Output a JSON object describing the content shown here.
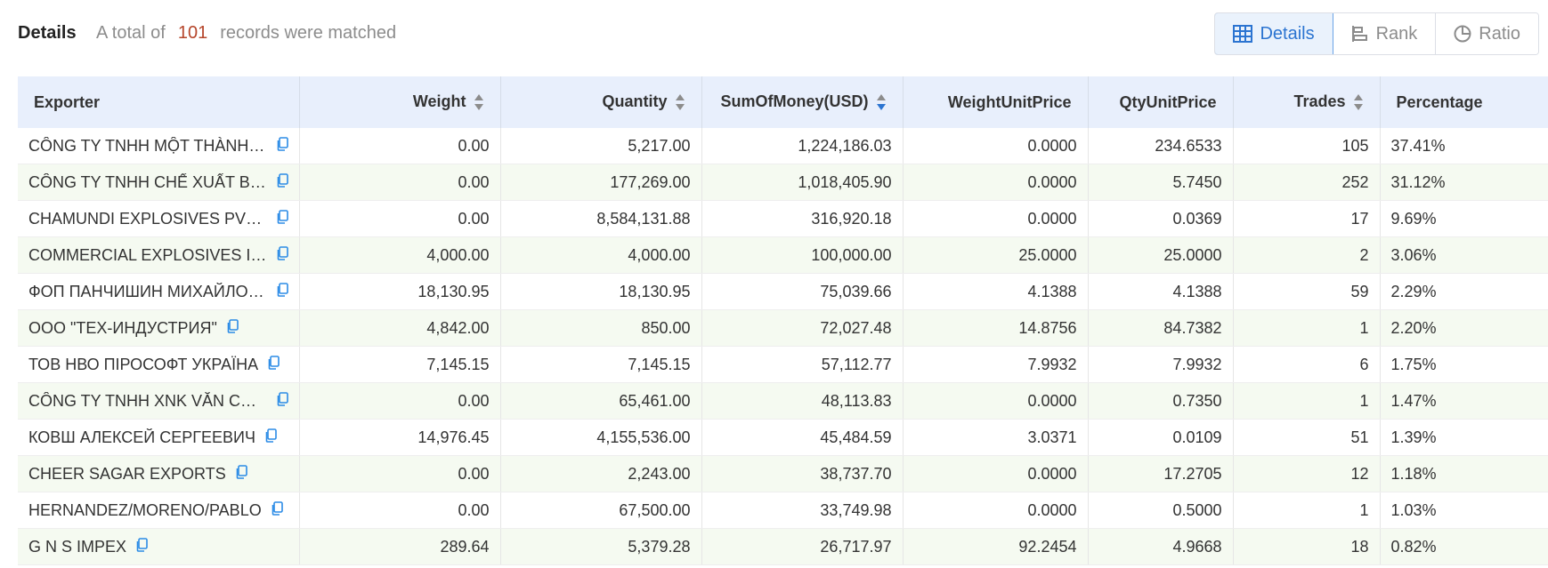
{
  "header": {
    "title": "Details",
    "summary_prefix": "A total of",
    "count": "101",
    "summary_suffix": "records were matched"
  },
  "views": [
    {
      "label": "Details",
      "icon": "table-icon",
      "active": true
    },
    {
      "label": "Rank",
      "icon": "bar-rank-icon",
      "active": false
    },
    {
      "label": "Ratio",
      "icon": "pie-icon",
      "active": false
    }
  ],
  "colors": {
    "accent": "#2b74d1",
    "count": "#b5452a",
    "header_bg": "#e8effc",
    "row_alt_bg": "#f5faf1"
  },
  "columns": [
    {
      "key": "exporter",
      "label": "Exporter",
      "sortable": false
    },
    {
      "key": "weight",
      "label": "Weight",
      "sortable": true,
      "sorted": "none"
    },
    {
      "key": "quantity",
      "label": "Quantity",
      "sortable": true,
      "sorted": "none"
    },
    {
      "key": "sum",
      "label": "SumOfMoney(USD)",
      "sortable": true,
      "sorted": "desc"
    },
    {
      "key": "wup",
      "label": "WeightUnitPrice",
      "sortable": false
    },
    {
      "key": "qup",
      "label": "QtyUnitPrice",
      "sortable": false
    },
    {
      "key": "trades",
      "label": "Trades",
      "sortable": true,
      "sorted": "none"
    },
    {
      "key": "pct",
      "label": "Percentage",
      "sortable": false
    }
  ],
  "rows": [
    {
      "exporter": "CÔNG TY TNHH MỘT THÀNH VIÊN …",
      "weight": "0.00",
      "quantity": "5,217.00",
      "sum": "1,224,186.03",
      "wup": "0.0000",
      "qup": "234.6533",
      "trades": "105",
      "pct": "37.41%"
    },
    {
      "exporter": "CÔNG TY TNHH CHẾ XUẤT BILLIO…",
      "weight": "0.00",
      "quantity": "177,269.00",
      "sum": "1,018,405.90",
      "wup": "0.0000",
      "qup": "5.7450",
      "trades": "252",
      "pct": "31.12%"
    },
    {
      "exporter": "CHAMUNDI EXPLOSIVES PVT LTD",
      "weight": "0.00",
      "quantity": "8,584,131.88",
      "sum": "316,920.18",
      "wup": "0.0000",
      "qup": "0.0369",
      "trades": "17",
      "pct": "9.69%"
    },
    {
      "exporter": "COMMERCIAL EXPLOSIVES INDIA …",
      "weight": "4,000.00",
      "quantity": "4,000.00",
      "sum": "100,000.00",
      "wup": "25.0000",
      "qup": "25.0000",
      "trades": "2",
      "pct": "3.06%"
    },
    {
      "exporter": "ФОП ПАНЧИШИН МИХАЙЛО ВАС…",
      "weight": "18,130.95",
      "quantity": "18,130.95",
      "sum": "75,039.66",
      "wup": "4.1388",
      "qup": "4.1388",
      "trades": "59",
      "pct": "2.29%"
    },
    {
      "exporter": "ООО \"ТЕХ-ИНДУСТРИЯ\"",
      "weight": "4,842.00",
      "quantity": "850.00",
      "sum": "72,027.48",
      "wup": "14.8756",
      "qup": "84.7382",
      "trades": "1",
      "pct": "2.20%"
    },
    {
      "exporter": "ТОВ НВО ПІРОСОФТ УКРАЇНА",
      "weight": "7,145.15",
      "quantity": "7,145.15",
      "sum": "57,112.77",
      "wup": "7.9932",
      "qup": "7.9932",
      "trades": "6",
      "pct": "1.75%"
    },
    {
      "exporter": "CÔNG TY TNHH XNK VĂN CHÍNH B…",
      "weight": "0.00",
      "quantity": "65,461.00",
      "sum": "48,113.83",
      "wup": "0.0000",
      "qup": "0.7350",
      "trades": "1",
      "pct": "1.47%"
    },
    {
      "exporter": "КОВШ АЛЕКСЕЙ СЕРГЕЕВИЧ",
      "weight": "14,976.45",
      "quantity": "4,155,536.00",
      "sum": "45,484.59",
      "wup": "3.0371",
      "qup": "0.0109",
      "trades": "51",
      "pct": "1.39%"
    },
    {
      "exporter": "CHEER SAGAR EXPORTS",
      "weight": "0.00",
      "quantity": "2,243.00",
      "sum": "38,737.70",
      "wup": "0.0000",
      "qup": "17.2705",
      "trades": "12",
      "pct": "1.18%"
    },
    {
      "exporter": "HERNANDEZ/MORENO/PABLO",
      "weight": "0.00",
      "quantity": "67,500.00",
      "sum": "33,749.98",
      "wup": "0.0000",
      "qup": "0.5000",
      "trades": "1",
      "pct": "1.03%"
    },
    {
      "exporter": "G N S IMPEX",
      "weight": "289.64",
      "quantity": "5,379.28",
      "sum": "26,717.97",
      "wup": "92.2454",
      "qup": "4.9668",
      "trades": "18",
      "pct": "0.82%"
    }
  ]
}
